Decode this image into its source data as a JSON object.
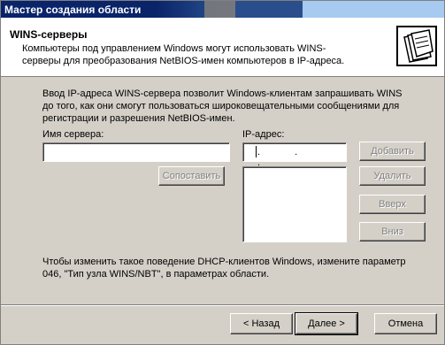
{
  "window": {
    "title": "Мастер создания области"
  },
  "header": {
    "title": "WINS-серверы",
    "subtitle": "Компьютеры под управлением Windows могут использовать WINS-серверы для преобразования NetBIOS-имен компьютеров в IP-адреса.",
    "icon": "folder-stack-icon"
  },
  "body": {
    "intro": "Ввод IP-адреса WINS-сервера позволит Windows-клиентам запрашивать WINS до того, как они смогут пользоваться широковещательными сообщениями для регистрации и разрешения NetBIOS-имен.",
    "server_name_label": "Имя сервера:",
    "server_name_value": "",
    "ip_label": "IP-адрес:",
    "ip_value": ". . .",
    "resolve_button": "Сопоставить",
    "add_button": "Добавить",
    "remove_button": "Удалить",
    "up_button": "Вверх",
    "down_button": "Вниз",
    "footer": "Чтобы изменить такое поведение DHCP-клиентов Windows, измените параметр 046, \"Тип узла WINS/NBT\", в параметрах области."
  },
  "nav": {
    "back": "< Назад",
    "next": "Далее >",
    "cancel": "Отмена"
  }
}
